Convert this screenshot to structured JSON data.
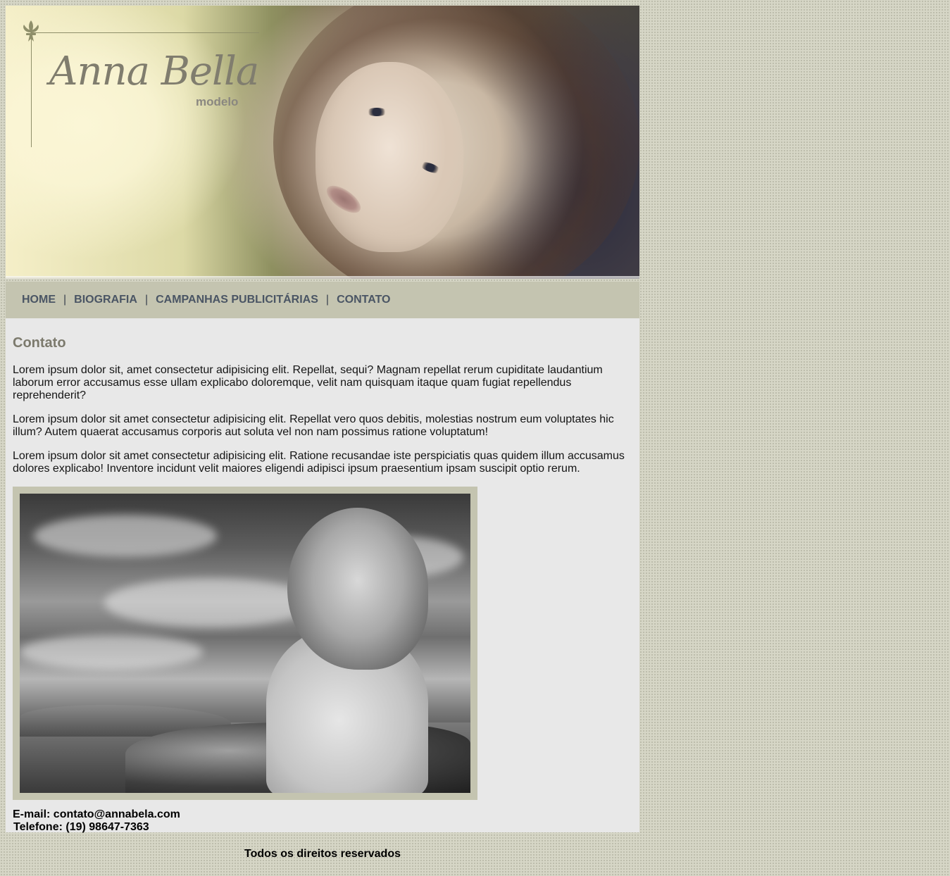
{
  "brand": {
    "name": "Anna Bella",
    "subtitle": "modelo"
  },
  "nav": {
    "items": [
      "HOME",
      "BIOGRAFIA",
      "CAMPANHAS PUBLICITÁRIAS",
      "CONTATO"
    ],
    "separator": "|"
  },
  "content": {
    "title": "Contato",
    "paragraphs": [
      "Lorem ipsum dolor sit, amet consectetur adipisicing elit. Repellat, sequi? Magnam repellat rerum cupiditate laudantium laborum error accusamus esse ullam explicabo doloremque, velit nam quisquam itaque quam fugiat repellendus reprehenderit?",
      "Lorem ipsum dolor sit amet consectetur adipisicing elit. Repellat vero quos debitis, molestias nostrum eum voluptates hic illum? Autem quaerat accusamus corporis aut soluta vel non nam possimus ratione voluptatum!",
      "Lorem ipsum dolor sit amet consectetur adipisicing elit. Ratione recusandae iste perspiciatis quas quidem illum accusamus dolores explicabo! Inventore incidunt velit maiores eligendi adipisci ipsum praesentium ipsam suscipit optio rerum."
    ],
    "email": "E-mail: contato@annabela.com",
    "phone": "Telefone: (19) 98647-7363"
  },
  "footer": {
    "text": "Todos os direitos reservados"
  },
  "colors": {
    "page_bg": "#d6d6c6",
    "nav_bg": "#c4c4b0",
    "nav_text": "#4a5564",
    "content_bg": "#e8e8e8",
    "title_color": "#7c7a6d"
  }
}
